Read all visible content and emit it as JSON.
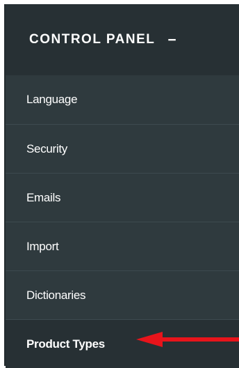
{
  "control_panel": {
    "title": "CONTROL PANEL",
    "collapse_symbol": "−",
    "items": [
      {
        "label": "Language"
      },
      {
        "label": "Security"
      },
      {
        "label": "Emails"
      },
      {
        "label": "Import"
      },
      {
        "label": "Dictionaries"
      },
      {
        "label": "Product Types",
        "active": true
      }
    ]
  },
  "annotation": {
    "icon": "red-arrow-left-icon",
    "color": "#e8141b"
  },
  "colors": {
    "panel_background": "#2f3a3e",
    "header_background": "#273034",
    "text": "#ffffff"
  }
}
